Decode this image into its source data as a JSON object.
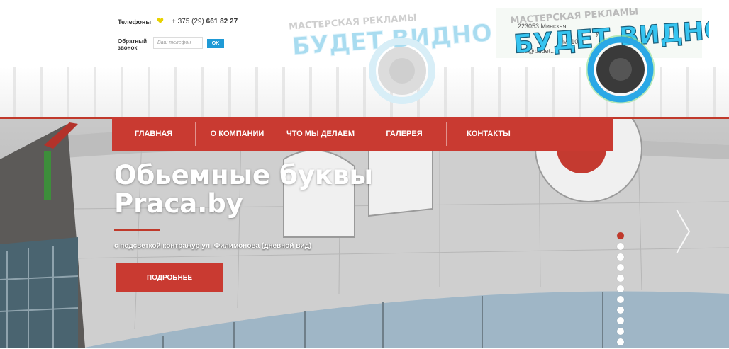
{
  "header": {
    "phone_label": "Телефоны",
    "phone_prefix": "+ 375 (29)",
    "phone_number": "661 82 27",
    "operator_icon": "velcom-heart-icon",
    "callback_label_line1": "Обратный",
    "callback_label_line2": "звонок",
    "callback_placeholder": "Ваш телефон",
    "callback_button": "OK",
    "logo_text": "БУДЕТ ВИДНО",
    "logo_tagline": "МАСТЕРСКАЯ РЕКЛАМЫ",
    "logo_contact_lines": [
      "223053 Минская",
      "ул.",
      "ком. 105",
      "info@budet..."
    ]
  },
  "nav": {
    "items": [
      "ГЛАВНАЯ",
      "О КОМПАНИИ",
      "ЧТО МЫ ДЕЛАЕМ",
      "ГАЛЕРЕЯ",
      "КОНТАКТЫ"
    ]
  },
  "slider": {
    "title_line1": "Обьемные буквы",
    "title_line2": "Praca.by",
    "subtitle": "с подсветкой контражур ул. Филимонова (дневной вид)",
    "button": "ПОДРОБНЕЕ",
    "slide_count": 11,
    "active_slide": 1,
    "next_icon": "chevron-right-icon"
  },
  "colors": {
    "brand_red": "#c93a31",
    "button_blue": "#1f9ad6",
    "logo_cyan": "#2fb6e6"
  }
}
